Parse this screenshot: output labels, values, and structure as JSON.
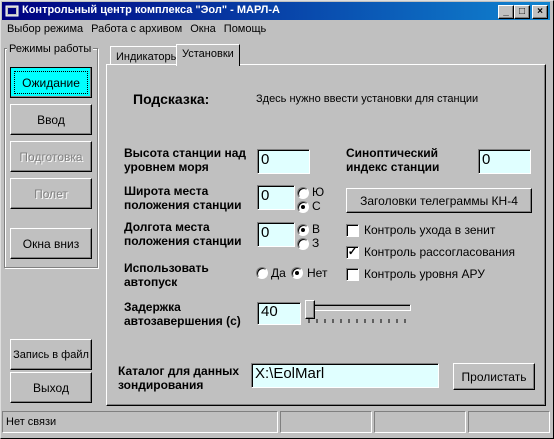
{
  "window": {
    "title": "Контрольный центр комплекса \"Эол\" - МАРЛ-А"
  },
  "titlebar_buttons": {
    "minimize": "_",
    "maximize": "□",
    "close": "×"
  },
  "menu": [
    "Выбор режима",
    "Работа с архивом",
    "Окна",
    "Помощь"
  ],
  "left_panel": {
    "group_title": "Режимы работы",
    "buttons": [
      {
        "label": "Ожидание",
        "state": "active"
      },
      {
        "label": "Ввод",
        "state": "enabled"
      },
      {
        "label": "Подготовка",
        "state": "disabled"
      },
      {
        "label": "Полет",
        "state": "disabled"
      },
      {
        "label": "Окна вниз",
        "state": "enabled"
      }
    ],
    "save_label": "Запись в файл",
    "exit_label": "Выход"
  },
  "tabs": [
    "Индикаторы",
    "Установки"
  ],
  "active_tab": "Установки",
  "hint": {
    "label": "Подсказка:",
    "text": "Здесь нужно ввести установки для станции"
  },
  "settings": {
    "height_label": "Высота станции над уровнем моря",
    "height_value": "0",
    "synoptic_label": "Синоптический индекс станции",
    "synoptic_value": "0",
    "latitude_label": "Широта места положения станции",
    "latitude_value": "0",
    "lat_opts": [
      "Ю",
      "С"
    ],
    "lat_selected": "С",
    "longitude_label": "Долгота места положения станции",
    "longitude_value": "0",
    "lon_opts": [
      "В",
      "З"
    ],
    "lon_selected": "В",
    "autopusk_label": "Использовать автопуск",
    "autopusk_opts": [
      "Да",
      "Нет"
    ],
    "autopusk_selected": "Нет",
    "delay_label": "Задержка автозавершения (с)",
    "delay_value": "40",
    "delay_slider_level": 0,
    "headers_button": "Заголовки телеграммы КН-4",
    "checks": [
      {
        "label": "Контроль ухода в зенит",
        "checked": false
      },
      {
        "label": "Контроль рассогласования",
        "checked": true
      },
      {
        "label": "Контроль уровня АРУ",
        "checked": false
      }
    ],
    "catalog_label": "Каталог для данных зондирования",
    "catalog_value": "X:\\EolMarl",
    "browse_button": "Пролистать"
  },
  "status": {
    "text": "Нет связи"
  },
  "colors": {
    "title_start": "#000080",
    "title_end": "#1084d0",
    "active_button": "#00ffff",
    "field_bg": "#e0ffff"
  }
}
